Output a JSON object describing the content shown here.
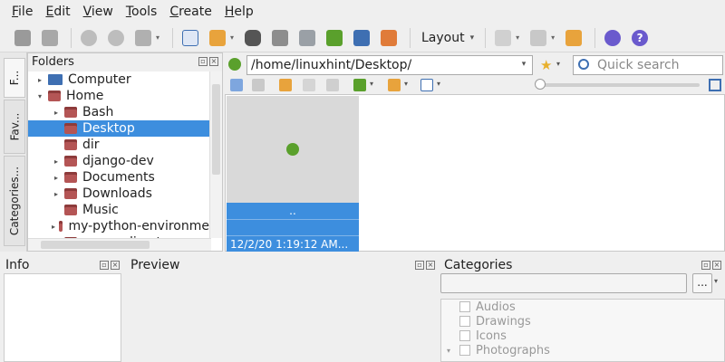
{
  "menu": [
    {
      "label": "File",
      "u": "F",
      "rest": "ile"
    },
    {
      "label": "Edit",
      "u": "E",
      "rest": "dit"
    },
    {
      "label": "View",
      "u": "V",
      "rest": "iew"
    },
    {
      "label": "Tools",
      "u": "T",
      "rest": "ools"
    },
    {
      "label": "Create",
      "u": "C",
      "rest": "reate"
    },
    {
      "label": "Help",
      "u": "H",
      "rest": "elp"
    }
  ],
  "toolbar": {
    "layout_label": "Layout",
    "icons": [
      "back-to-browser-icon",
      "fullscreen-icon",
      "rotate-left-icon",
      "rotate-right-icon",
      "edit-image-icon",
      "properties-icon",
      "import-icon",
      "find-icon",
      "print-icon",
      "slideshow-icon",
      "presentation-icon",
      "screenshot-icon",
      "sendto-icon"
    ],
    "colors": {
      "blue": "#3e6fb2",
      "green": "#5aa02c",
      "orange": "#e8a33c",
      "gray": "#8d8d8d",
      "purple": "#6a5acd"
    }
  },
  "vtabs": [
    "F...",
    "Fav...",
    "Categories..."
  ],
  "folders": {
    "title": "Folders",
    "items": [
      {
        "label": "Computer",
        "indent": 0,
        "expander": "▸",
        "icon": "computer-icon",
        "selected": false
      },
      {
        "label": "Home",
        "indent": 0,
        "expander": "▾",
        "icon": "folder-icon",
        "selected": false
      },
      {
        "label": "Bash",
        "indent": 1,
        "expander": "▸",
        "icon": "folder-icon",
        "selected": false
      },
      {
        "label": "Desktop",
        "indent": 1,
        "expander": "",
        "icon": "folder-icon",
        "selected": true
      },
      {
        "label": "dir",
        "indent": 1,
        "expander": "",
        "icon": "folder-icon",
        "selected": false
      },
      {
        "label": "django-dev",
        "indent": 1,
        "expander": "▸",
        "icon": "folder-icon",
        "selected": false
      },
      {
        "label": "Documents",
        "indent": 1,
        "expander": "▸",
        "icon": "folder-icon",
        "selected": false
      },
      {
        "label": "Downloads",
        "indent": 1,
        "expander": "▸",
        "icon": "folder-icon",
        "selected": false
      },
      {
        "label": "Music",
        "indent": 1,
        "expander": "",
        "icon": "folder-icon",
        "selected": false
      },
      {
        "label": "my-python-environme",
        "indent": 1,
        "expander": "▸",
        "icon": "folder-icon",
        "selected": false
      },
      {
        "label": "mysqudirectory",
        "indent": 1,
        "expander": "▸",
        "icon": "folder-icon",
        "selected": false
      }
    ]
  },
  "address": {
    "path": "/home/linuxhint/Desktop/",
    "search_placeholder": "Quick search"
  },
  "thumb": {
    "name": "..",
    "date": "12/2/20 1:19:12 AM..."
  },
  "bottom": {
    "info_title": "Info",
    "preview_title": "Preview",
    "categories_title": "Categories",
    "categories_btn": "...",
    "categories": [
      {
        "label": "Audios",
        "expander": ""
      },
      {
        "label": "Drawings",
        "expander": ""
      },
      {
        "label": "Icons",
        "expander": ""
      },
      {
        "label": "Photographs",
        "expander": "▾"
      }
    ]
  },
  "zoom": {
    "level": 0.0
  }
}
